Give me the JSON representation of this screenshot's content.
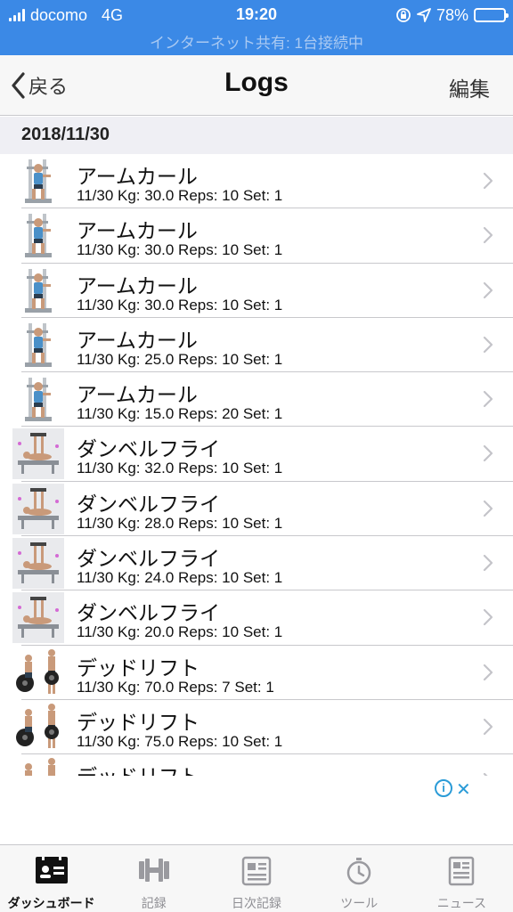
{
  "status_bar": {
    "carrier": "docomo",
    "network": "4G",
    "time": "19:20",
    "battery": "78%",
    "battery_level": 0.78,
    "hotspot": "インターネット共有: 1台接続中"
  },
  "nav": {
    "back_label": "戻る",
    "title": "Logs",
    "edit_label": "編集"
  },
  "section": {
    "date": "2018/11/30"
  },
  "logs": [
    {
      "name": "アームカール",
      "detail": "11/30  Kg: 30.0  Reps: 10  Set: 1",
      "icon": "arm-curl-machine-icon"
    },
    {
      "name": "アームカール",
      "detail": "11/30  Kg: 30.0  Reps: 10  Set: 1",
      "icon": "arm-curl-machine-icon"
    },
    {
      "name": "アームカール",
      "detail": "11/30  Kg: 30.0  Reps: 10  Set: 1",
      "icon": "arm-curl-machine-icon"
    },
    {
      "name": "アームカール",
      "detail": "11/30  Kg: 25.0  Reps: 10  Set: 1",
      "icon": "arm-curl-machine-icon"
    },
    {
      "name": "アームカール",
      "detail": "11/30  Kg: 15.0  Reps: 20  Set: 1",
      "icon": "arm-curl-machine-icon"
    },
    {
      "name": "ダンベルフライ",
      "detail": "11/30  Kg: 32.0  Reps: 10  Set: 1",
      "icon": "dumbbell-fly-icon"
    },
    {
      "name": "ダンベルフライ",
      "detail": "11/30  Kg: 28.0  Reps: 10  Set: 1",
      "icon": "dumbbell-fly-icon"
    },
    {
      "name": "ダンベルフライ",
      "detail": "11/30  Kg: 24.0  Reps: 10  Set: 1",
      "icon": "dumbbell-fly-icon"
    },
    {
      "name": "ダンベルフライ",
      "detail": "11/30  Kg: 20.0  Reps: 10  Set: 1",
      "icon": "dumbbell-fly-icon"
    },
    {
      "name": "デッドリフト",
      "detail": "11/30  Kg: 70.0  Reps: 7  Set: 1",
      "icon": "deadlift-icon"
    },
    {
      "name": "デッドリフト",
      "detail": "11/30  Kg: 75.0  Reps: 10  Set: 1",
      "icon": "deadlift-icon"
    },
    {
      "name": "デッドリフト",
      "detail": "",
      "icon": "deadlift-icon"
    }
  ],
  "tabs": [
    {
      "label": "ダッシュボード",
      "icon": "dashboard-icon",
      "active": true
    },
    {
      "label": "記録",
      "icon": "dumbbell-icon",
      "active": false
    },
    {
      "label": "日次記録",
      "icon": "daily-log-icon",
      "active": false
    },
    {
      "label": "ツール",
      "icon": "stopwatch-icon",
      "active": false
    },
    {
      "label": "ニュース",
      "icon": "news-icon",
      "active": false
    }
  ],
  "colors": {
    "status_bar": "#3b89e6",
    "ad_accent": "#2a9bd7",
    "tab_active": "#111111",
    "tab_inactive": "#8e8e93"
  }
}
